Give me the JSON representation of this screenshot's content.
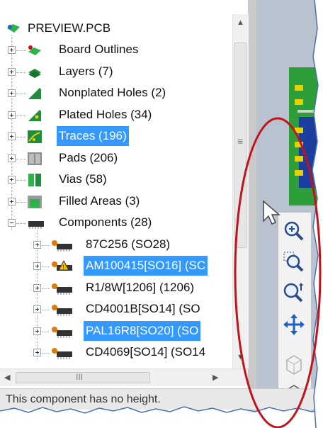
{
  "tree": {
    "root": "PREVIEW.PCB",
    "items": [
      {
        "label": "Board Outlines",
        "icon": "board-outline-icon"
      },
      {
        "label": "Layers (7)",
        "icon": "layers-icon"
      },
      {
        "label": "Nonplated Holes (2)",
        "icon": "nonplated-holes-icon"
      },
      {
        "label": "Plated Holes (34)",
        "icon": "plated-holes-icon"
      },
      {
        "label": "Traces (196)",
        "icon": "traces-icon"
      },
      {
        "label": "Pads (206)",
        "icon": "pads-icon"
      },
      {
        "label": "Vias (58)",
        "icon": "vias-icon"
      },
      {
        "label": "Filled Areas (3)",
        "icon": "filled-areas-icon"
      },
      {
        "label": "Components (28)",
        "icon": "components-icon"
      }
    ],
    "components": [
      {
        "label": "87C256 (SO28)"
      },
      {
        "label": "AM100415[SO16] (SC"
      },
      {
        "label": "R1/8W[1206] (1206)"
      },
      {
        "label": "CD4001B[SO14] (SO"
      },
      {
        "label": "PAL16R8[SO20] (SO"
      },
      {
        "label": "CD4069[SO14] (SO14"
      }
    ]
  },
  "scroll": {
    "h_thumb_grip": "III",
    "v_thumb_grip": "≡"
  },
  "status": {
    "text": "This component has no height."
  },
  "colors": {
    "selection": "#3399ff",
    "highlight_circle": "#c0141a",
    "pcb_green": "#2e9e3a",
    "pcb_blue": "#1c3f9f"
  }
}
